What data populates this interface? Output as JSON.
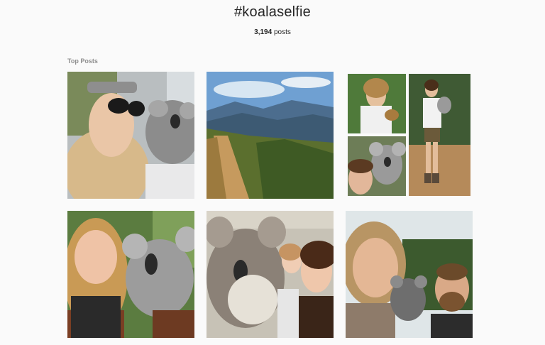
{
  "header": {
    "hashtag": "#koalaselfie",
    "count_number": "3,194",
    "count_suffix": " posts"
  },
  "sections": {
    "top_posts_label": "Top Posts"
  },
  "posts": [
    {
      "id": "post-1",
      "icon": "koala-selfie-photo"
    },
    {
      "id": "post-2",
      "icon": "mountain-landscape-photo"
    },
    {
      "id": "post-3",
      "icon": "collage-photo"
    },
    {
      "id": "post-4",
      "icon": "koala-selfie-photo"
    },
    {
      "id": "post-5",
      "icon": "koala-selfie-photo"
    },
    {
      "id": "post-6",
      "icon": "koala-selfie-photo"
    }
  ]
}
